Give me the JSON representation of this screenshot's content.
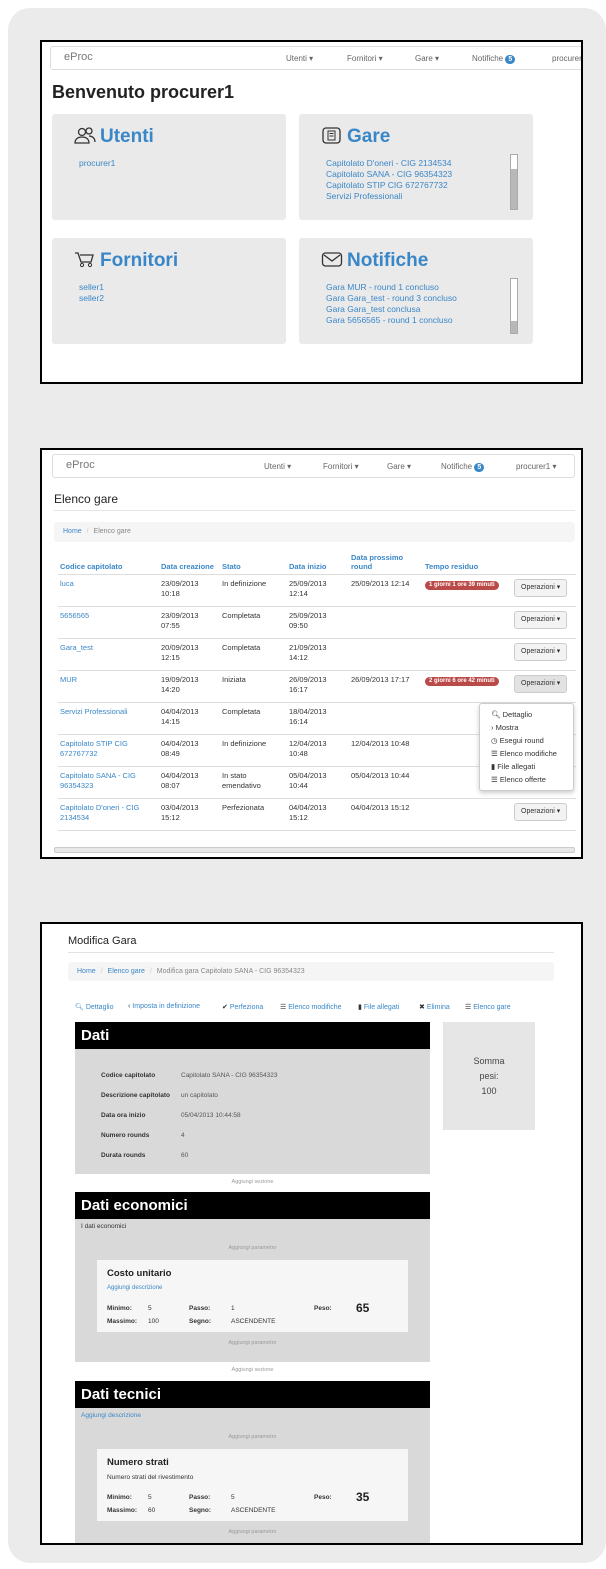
{
  "s1": {
    "nav": {
      "brand": "eProc",
      "utenti": "Utenti ▾",
      "fornitori": "Fornitori ▾",
      "gare": "Gare ▾",
      "notifiche": "Notifiche",
      "badge": "5",
      "user": "procurer1"
    },
    "welcome": "Benvenuto procurer1",
    "utenti": {
      "title": "Utenti",
      "items": [
        "procurer1"
      ]
    },
    "gare": {
      "title": "Gare",
      "items": [
        "Capitolato D'oneri - CIG 2134534",
        "Capitolato SANA - CIG 96354323",
        "Capitolato STIP CIG 672767732",
        "Servizi Professionali"
      ]
    },
    "fornitori": {
      "title": "Fornitori",
      "items": [
        "seller1",
        "seller2"
      ]
    },
    "notifiche": {
      "title": "Notifiche",
      "items": [
        "Gara MUR - round 1 concluso",
        "Gara Gara_test - round 3 concluso",
        "Gara Gara_test conclusa",
        "Gara 5656565 - round 1 concluso"
      ]
    }
  },
  "s2": {
    "nav": {
      "brand": "eProc",
      "utenti": "Utenti ▾",
      "fornitori": "Fornitori ▾",
      "gare": "Gare ▾",
      "notifiche": "Notifiche",
      "badge": "5",
      "user": "procurer1 ▾"
    },
    "title": "Elenco gare",
    "breadcrumb": {
      "home": "Home",
      "sep": "/",
      "current": "Elenco gare"
    },
    "columns": [
      "Codice capitolato",
      "Data creazione",
      "Stato",
      "Data inizio",
      "Data prossimo round",
      "Tempo residuo"
    ],
    "rows": [
      {
        "code": "luca",
        "created": "23/09/2013 10:18",
        "status": "In definizione",
        "start": "25/09/2013 12:14",
        "next": "25/09/2013 12:14",
        "remaining": "1 giorni 1 ore 39 minuti"
      },
      {
        "code": "5656565",
        "created": "23/09/2013 07:55",
        "status": "Completata",
        "start": "25/09/2013 09:50",
        "next": "",
        "remaining": ""
      },
      {
        "code": "Gara_test",
        "created": "20/09/2013 12:15",
        "status": "Completata",
        "start": "21/09/2013 14:12",
        "next": "",
        "remaining": ""
      },
      {
        "code": "MUR",
        "created": "19/09/2013 14:20",
        "status": "Iniziata",
        "start": "26/09/2013 16:17",
        "next": "26/09/2013 17:17",
        "remaining": "2 giorni 6 ore 42 minuti"
      },
      {
        "code": "Servizi Professionali",
        "created": "04/04/2013 14:15",
        "status": "Completata",
        "start": "18/04/2013 16:14",
        "next": "",
        "remaining": ""
      },
      {
        "code": "Capitolato STIP CIG 672767732",
        "created": "04/04/2013 08:49",
        "status": "In definizione",
        "start": "12/04/2013 10:48",
        "next": "12/04/2013 10:48",
        "remaining": ""
      },
      {
        "code": "Capitolato SANA - CIG 96354323",
        "created": "04/04/2013 08:07",
        "status": "In stato emendativo",
        "start": "05/04/2013 10:44",
        "next": "05/04/2013 10:44",
        "remaining": ""
      },
      {
        "code": "Capitolato D'oneri - CIG 2134534",
        "created": "03/04/2013 15:12",
        "status": "Perfezionata",
        "start": "04/04/2013 15:12",
        "next": "04/04/2013 15:12",
        "remaining": ""
      }
    ],
    "op_label": "Operazioni ▾",
    "menu": [
      "Dettaglio",
      "Mostra",
      "Esegui round",
      "Elenco modifiche",
      "File allegati",
      "Elenco offerte"
    ]
  },
  "s3": {
    "title": "Modifica Gara",
    "breadcrumb": {
      "home": "Home",
      "sep": "/",
      "list": "Elenco gare",
      "current": "Modifica gara Capitolato SANA - CIG 96354323"
    },
    "toolbar": {
      "dettaglio": "Dettaglio",
      "imposta": "Imposta in definizione",
      "perfeziona": "Perfeziona",
      "modifiche": "Elenco modifiche",
      "allegati": "File allegati",
      "elimina": "Elimina",
      "elenco": "Elenco gare"
    },
    "dati": {
      "title": "Dati",
      "labels": [
        "Codice capitolato",
        "Descrizione capitolato",
        "Data ora inizio",
        "Numero rounds",
        "Durata rounds"
      ],
      "values": [
        "Capitolato SANA - CIG 96354323",
        "un capitolato",
        "05/04/2013 10:44:58",
        "4",
        "60"
      ]
    },
    "somma": {
      "label": "Somma pesi:",
      "value": "100"
    },
    "add_section": "Aggiungi sezione",
    "add_param": "Aggiungi parametro",
    "economici": {
      "title": "Dati economici",
      "desc": "I dati economici",
      "param": {
        "name": "Costo unitario",
        "desc": "Aggiungi descrizione",
        "min_label": "Minimo:",
        "min": "5",
        "max_label": "Massimo:",
        "max": "100",
        "step_label": "Passo:",
        "step": "1",
        "sign_label": "Segno:",
        "sign": "ASCENDENTE",
        "weight_label": "Peso:",
        "weight": "65"
      }
    },
    "tecnici": {
      "title": "Dati tecnici",
      "desc": "Aggiungi descrizione",
      "param": {
        "name": "Numero strati",
        "desc": "Numero strati del rivestimento",
        "min_label": "Minimo:",
        "min": "5",
        "max_label": "Massimo:",
        "max": "60",
        "step_label": "Passo:",
        "step": "5",
        "sign_label": "Segno:",
        "sign": "ASCENDENTE",
        "weight_label": "Peso:",
        "weight": "35"
      }
    }
  },
  "colors": {
    "accent": "#3a87c8",
    "danger": "#b94a48",
    "panel": "#eaeaea",
    "section_head": "#000000"
  }
}
